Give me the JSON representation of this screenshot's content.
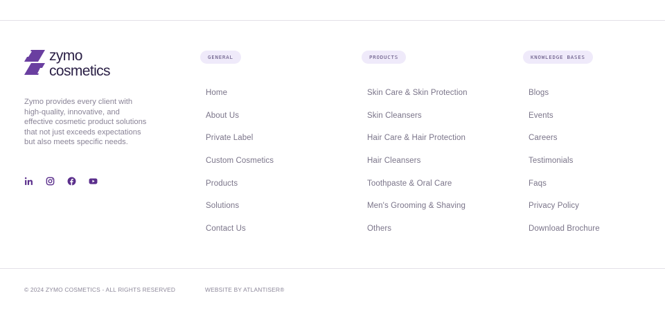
{
  "brand": {
    "name_line1": "zymo",
    "name_line2": "cosmetics",
    "logo_icon": "zymo-logo-mark",
    "accent_color": "#6a3fa0",
    "description": "Zymo provides every client with high-quality, innovative, and effective cosmetic product solutions that not just exceeds expectations but also meets specific needs."
  },
  "social": [
    {
      "icon": "linkedin-icon"
    },
    {
      "icon": "instagram-icon"
    },
    {
      "icon": "facebook-icon"
    },
    {
      "icon": "youtube-icon"
    }
  ],
  "columns": {
    "general": {
      "heading": "GENERAL",
      "links": [
        "Home",
        "About Us",
        "Private Label",
        "Custom Cosmetics",
        "Products",
        "Solutions",
        "Contact Us"
      ]
    },
    "products": {
      "heading": "PRODUCTS",
      "links": [
        "Skin Care & Skin Protection",
        "Skin Cleansers",
        "Hair Care & Hair Protection",
        "Hair Cleansers",
        "Toothpaste & Oral Care",
        "Men's Grooming & Shaving",
        "Others"
      ]
    },
    "knowledge": {
      "heading": "KNOWLEDGE BASES",
      "links": [
        "Blogs",
        "Events",
        "Careers",
        "Testimonials",
        "Faqs",
        "Privacy Policy",
        "Download Brochure"
      ]
    }
  },
  "bottom": {
    "copyright": "© 2024 ZYMO COSMETICS - ALL RIGHTS RESERVED",
    "credit": "WEBSITE BY ATLANTISER®"
  }
}
